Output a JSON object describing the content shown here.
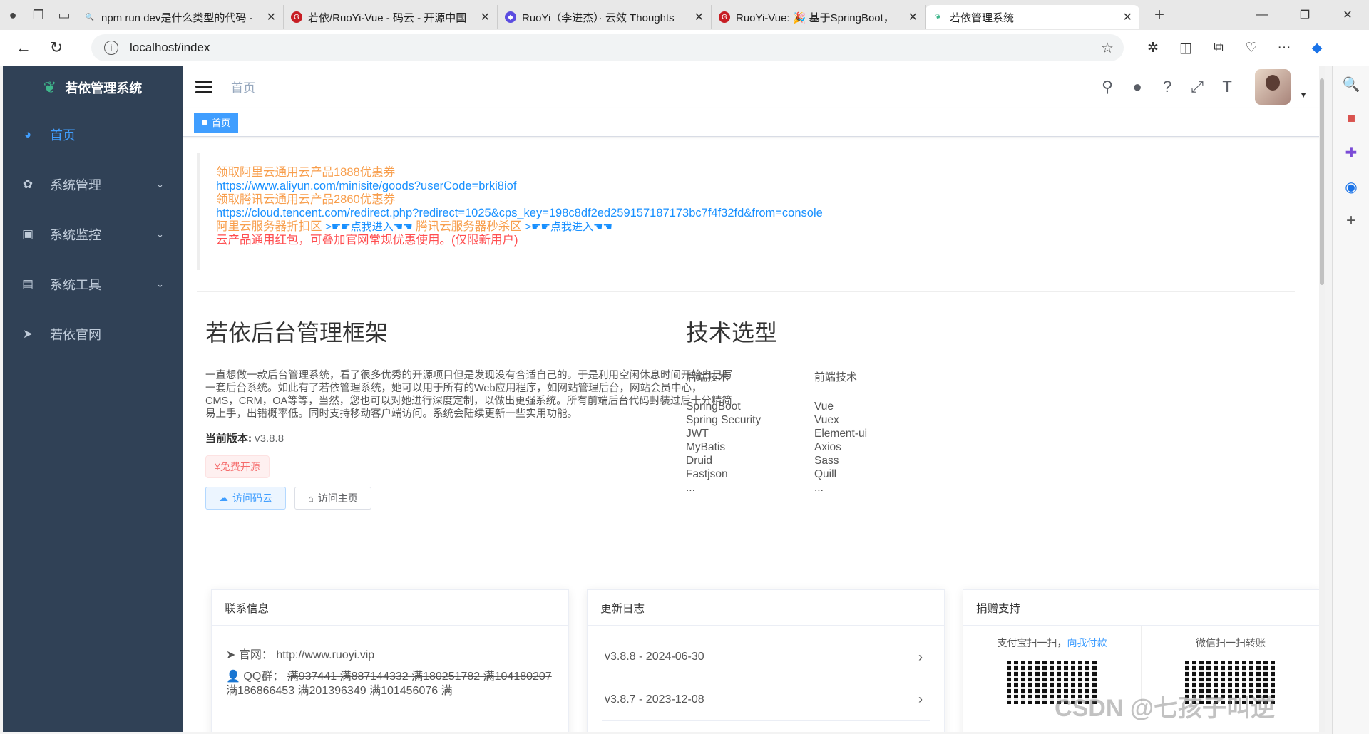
{
  "browser": {
    "tabs": [
      {
        "title": "npm run dev是什么类型的代码 - ",
        "icon": "search-icon"
      },
      {
        "title": "若依/RuoYi-Vue - 码云 - 开源中国",
        "icon": "gitee-icon"
      },
      {
        "title": "RuoYi（李进杰）· 云效 Thoughts",
        "icon": "thoughts-icon"
      },
      {
        "title": "RuoYi-Vue: 🎉 基于SpringBoot，",
        "icon": "gitee-icon"
      },
      {
        "title": "若依管理系统",
        "icon": "ruoyi-icon"
      }
    ],
    "url": "localhost/index"
  },
  "app": {
    "logo_title": "若依管理系统",
    "menu": [
      {
        "label": "首页",
        "icon": "dashboard-icon",
        "active": true
      },
      {
        "label": "系统管理",
        "icon": "gear-icon",
        "expandable": true
      },
      {
        "label": "系统监控",
        "icon": "monitor-icon",
        "expandable": true
      },
      {
        "label": "系统工具",
        "icon": "toolbox-icon",
        "expandable": true
      },
      {
        "label": "若依官网",
        "icon": "send-icon"
      }
    ],
    "breadcrumb": "首页",
    "active_tag": "首页"
  },
  "notice": {
    "line1": "领取阿里云通用云产品1888优惠券",
    "line2": "https://www.aliyun.com/minisite/goods?userCode=brki8iof",
    "line3": "领取腾讯云通用云产品2860优惠券",
    "line4": "https://cloud.tencent.com/redirect.php?redirect=1025&cps_key=198c8df2ed259157187173bc7f4f32fd&from=console",
    "line5a": "阿里云服务器折扣区",
    "line5b": ">☛☛点我进入☚☚",
    "line5c": "腾讯云服务器秒杀区",
    "line5d": ">☛☛点我进入☚☚",
    "line6": "云产品通用红包，可叠加官网常规优惠使用。(仅限新用户)"
  },
  "intro": {
    "title": "若依后台管理框架",
    "desc": "一直想做一款后台管理系统，看了很多优秀的开源项目但是发现没有合适自己的。于是利用空闲休息时间开始自己写一套后台系统。如此有了若依管理系统，她可以用于所有的Web应用程序，如网站管理后台，网站会员中心，CMS，CRM，OA等等，当然，您也可以对她进行深度定制，以做出更强系统。所有前端后台代码封装过后十分精简易上手，出错概率低。同时支持移动客户端访问。系统会陆续更新一些实用功能。",
    "version_label": "当前版本:",
    "version": "v3.8.8",
    "free_tag": "¥免费开源",
    "btn_gitee": "访问码云",
    "btn_home": "访问主页"
  },
  "tech": {
    "title": "技术选型",
    "backend_title": "后端技术",
    "backend": [
      "SpringBoot",
      "Spring Security",
      "JWT",
      "MyBatis",
      "Druid",
      "Fastjson",
      "..."
    ],
    "frontend_title": "前端技术",
    "frontend": [
      "Vue",
      "Vuex",
      "Element-ui",
      "Axios",
      "Sass",
      "Quill",
      "..."
    ]
  },
  "cards": {
    "contact": {
      "title": "联系信息",
      "site_label": "官网：",
      "site": "http://www.ruoyi.vip",
      "qq_label": "QQ群：",
      "qq_groups": "满937441 满887144332 满180251782 满104180207 满186866453 满201396349 满101456076 满"
    },
    "changelog": {
      "title": "更新日志",
      "items": [
        "v3.8.8 - 2024-06-30",
        "v3.8.7 - 2023-12-08"
      ]
    },
    "donate": {
      "title": "捐赠支持",
      "alipay": "支付宝扫一扫，",
      "alipay_link": "向我付款",
      "wechat": "微信扫一扫转账"
    }
  },
  "watermark": "CSDN @七孩子叫逆"
}
